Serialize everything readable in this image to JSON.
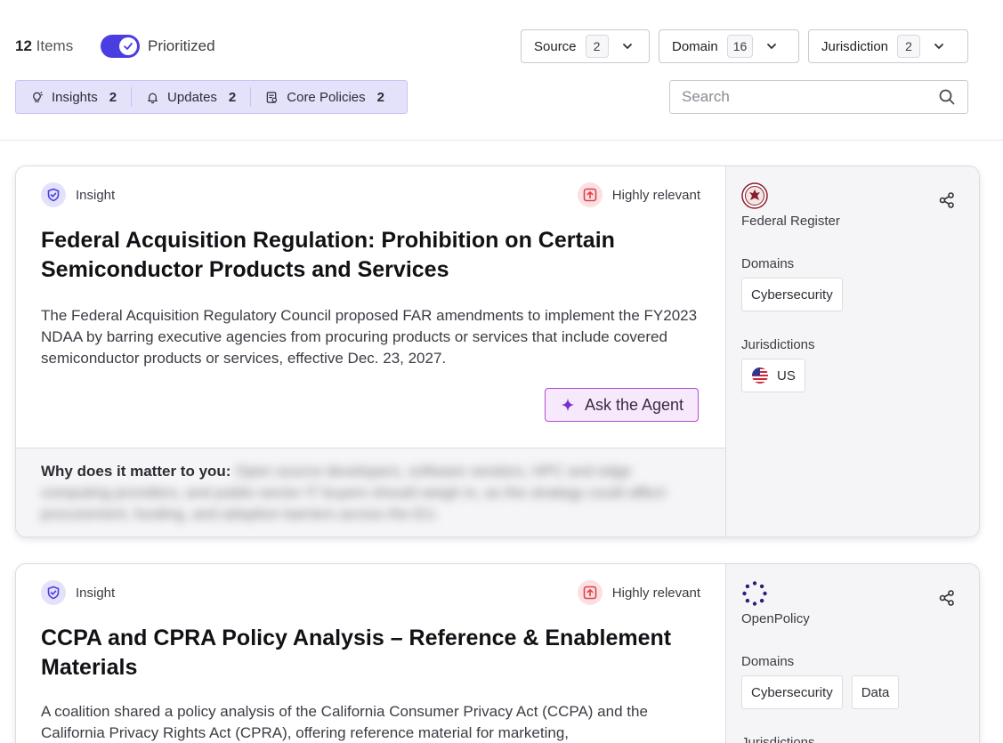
{
  "header": {
    "items_count": "12",
    "items_label": "Items",
    "prioritized_label": "Prioritized",
    "prioritized_on": true,
    "filters": [
      {
        "label": "Source",
        "count": "2"
      },
      {
        "label": "Domain",
        "count": "16"
      },
      {
        "label": "Jurisdiction",
        "count": "2"
      }
    ],
    "tabs": [
      {
        "label": "Insights",
        "count": "2",
        "icon": "lightbulb-icon"
      },
      {
        "label": "Updates",
        "count": "2",
        "icon": "bell-icon"
      },
      {
        "label": "Core Policies",
        "count": "2",
        "icon": "policy-doc-icon"
      }
    ],
    "search": {
      "placeholder": "Search",
      "value": ""
    }
  },
  "cards": [
    {
      "type": "Insight",
      "relevance": "Highly relevant",
      "title": "Federal Acquisition Regulation: Prohibition on Certain Semiconductor Products and Services",
      "description": "The Federal Acquisition Regulatory Council proposed FAR amendments to implement the FY2023 NDAA by barring executive agencies from procuring products or services that include covered semiconductor products or services, effective Dec. 23, 2027.",
      "ask_label": "Ask the Agent",
      "why_label": "Why does it matter to you:",
      "why_text": "Open source developers, software vendors, HPC and edge computing providers, and public-sector IT buyers should weigh in, as the strategy could affect procurement, funding, and adoption barriers across the EU.",
      "source": "Federal Register",
      "domains_label": "Domains",
      "domains": [
        "Cybersecurity"
      ],
      "jurisdictions_label": "Jurisdictions",
      "jurisdictions": [
        "US"
      ]
    },
    {
      "type": "Insight",
      "relevance": "Highly relevant",
      "title": "CCPA and CPRA Policy Analysis – Reference & Enablement Materials",
      "description": "A coalition shared a policy analysis of the California Consumer Privacy Act (CCPA) and the California Privacy Rights Act (CPRA), offering reference material for marketing,",
      "source": "OpenPolicy",
      "domains_label": "Domains",
      "domains": [
        "Cybersecurity",
        "Data"
      ],
      "jurisdictions_label": "Jurisdictions"
    }
  ],
  "colors": {
    "accent": "#4a3ee0",
    "tab_bg": "#e4e2fb",
    "relevance_bg": "#fbe0e1",
    "relevance_icon": "#e0404a",
    "agent_border": "#b24cd6"
  }
}
